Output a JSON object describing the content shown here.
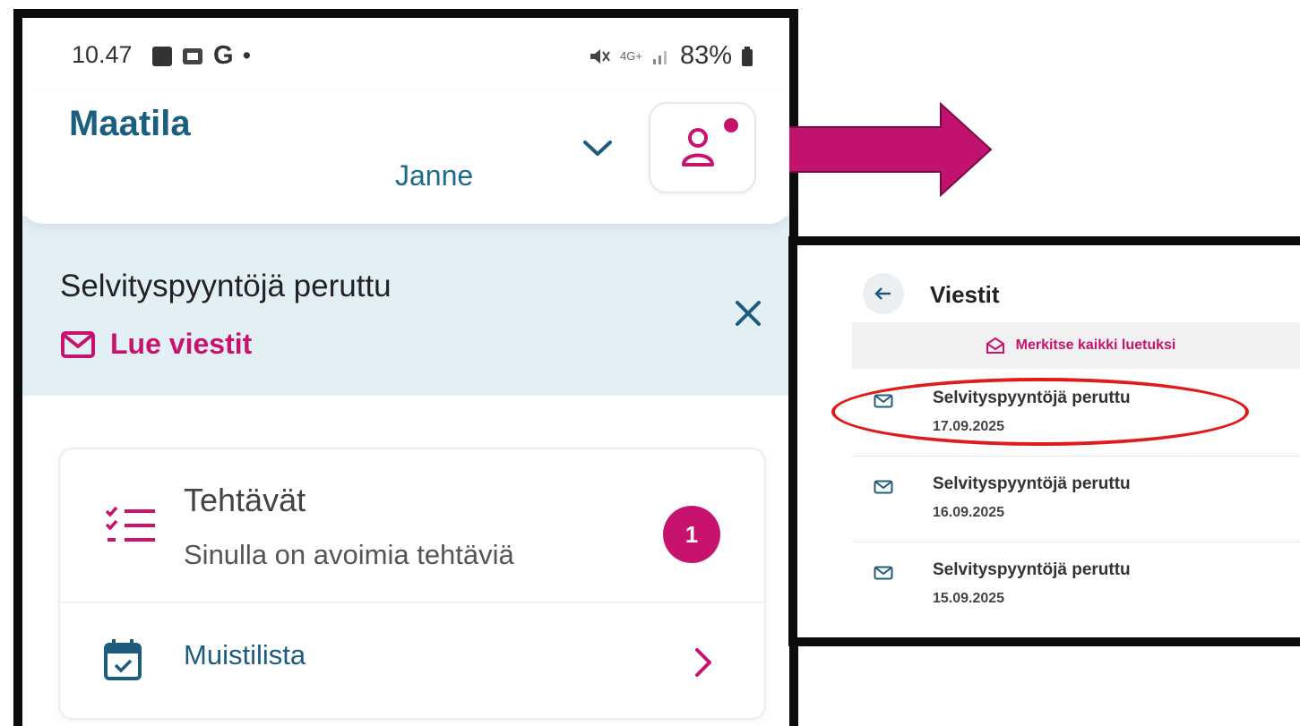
{
  "status_bar": {
    "time": "10.47",
    "carrier_letter": "G",
    "dot": "•",
    "network": "4G+",
    "battery": "83%"
  },
  "header": {
    "app_title": "Maatila",
    "user_name": "Janne",
    "profile_has_notification": true
  },
  "banner": {
    "title": "Selvityspyyntöjä peruttu",
    "link": "Lue viestit"
  },
  "cards": {
    "tasks": {
      "title": "Tehtävät",
      "subtitle": "Sinulla on avoimia tehtäviä",
      "badge": "1"
    },
    "memo": {
      "title": "Muistilista"
    }
  },
  "inbox": {
    "title": "Viestit",
    "mark_all": "Merkitse kaikki luetuksi",
    "messages": [
      {
        "title": "Selvityspyyntöjä peruttu",
        "date": "17.09.2025",
        "highlighted": true
      },
      {
        "title": "Selvityspyyntöjä peruttu",
        "date": "16.09.2025",
        "highlighted": false
      },
      {
        "title": "Selvityspyyntöjä peruttu",
        "date": "15.09.2025",
        "highlighted": false
      }
    ]
  },
  "colors": {
    "brand_blue": "#1a5e82",
    "accent_magenta": "#c8136e",
    "banner_bg": "#e2f0f6",
    "highlight_red": "#e01b1b"
  },
  "icons": [
    "checkbox-icon",
    "sim-icon",
    "mute-icon",
    "signal-icon",
    "battery-icon",
    "chevron-down-icon",
    "person-icon",
    "mail-icon",
    "close-icon",
    "task-list-icon",
    "calendar-icon",
    "chevron-right-icon",
    "arrow-right-icon",
    "arrow-left-icon",
    "mail-open-icon"
  ]
}
